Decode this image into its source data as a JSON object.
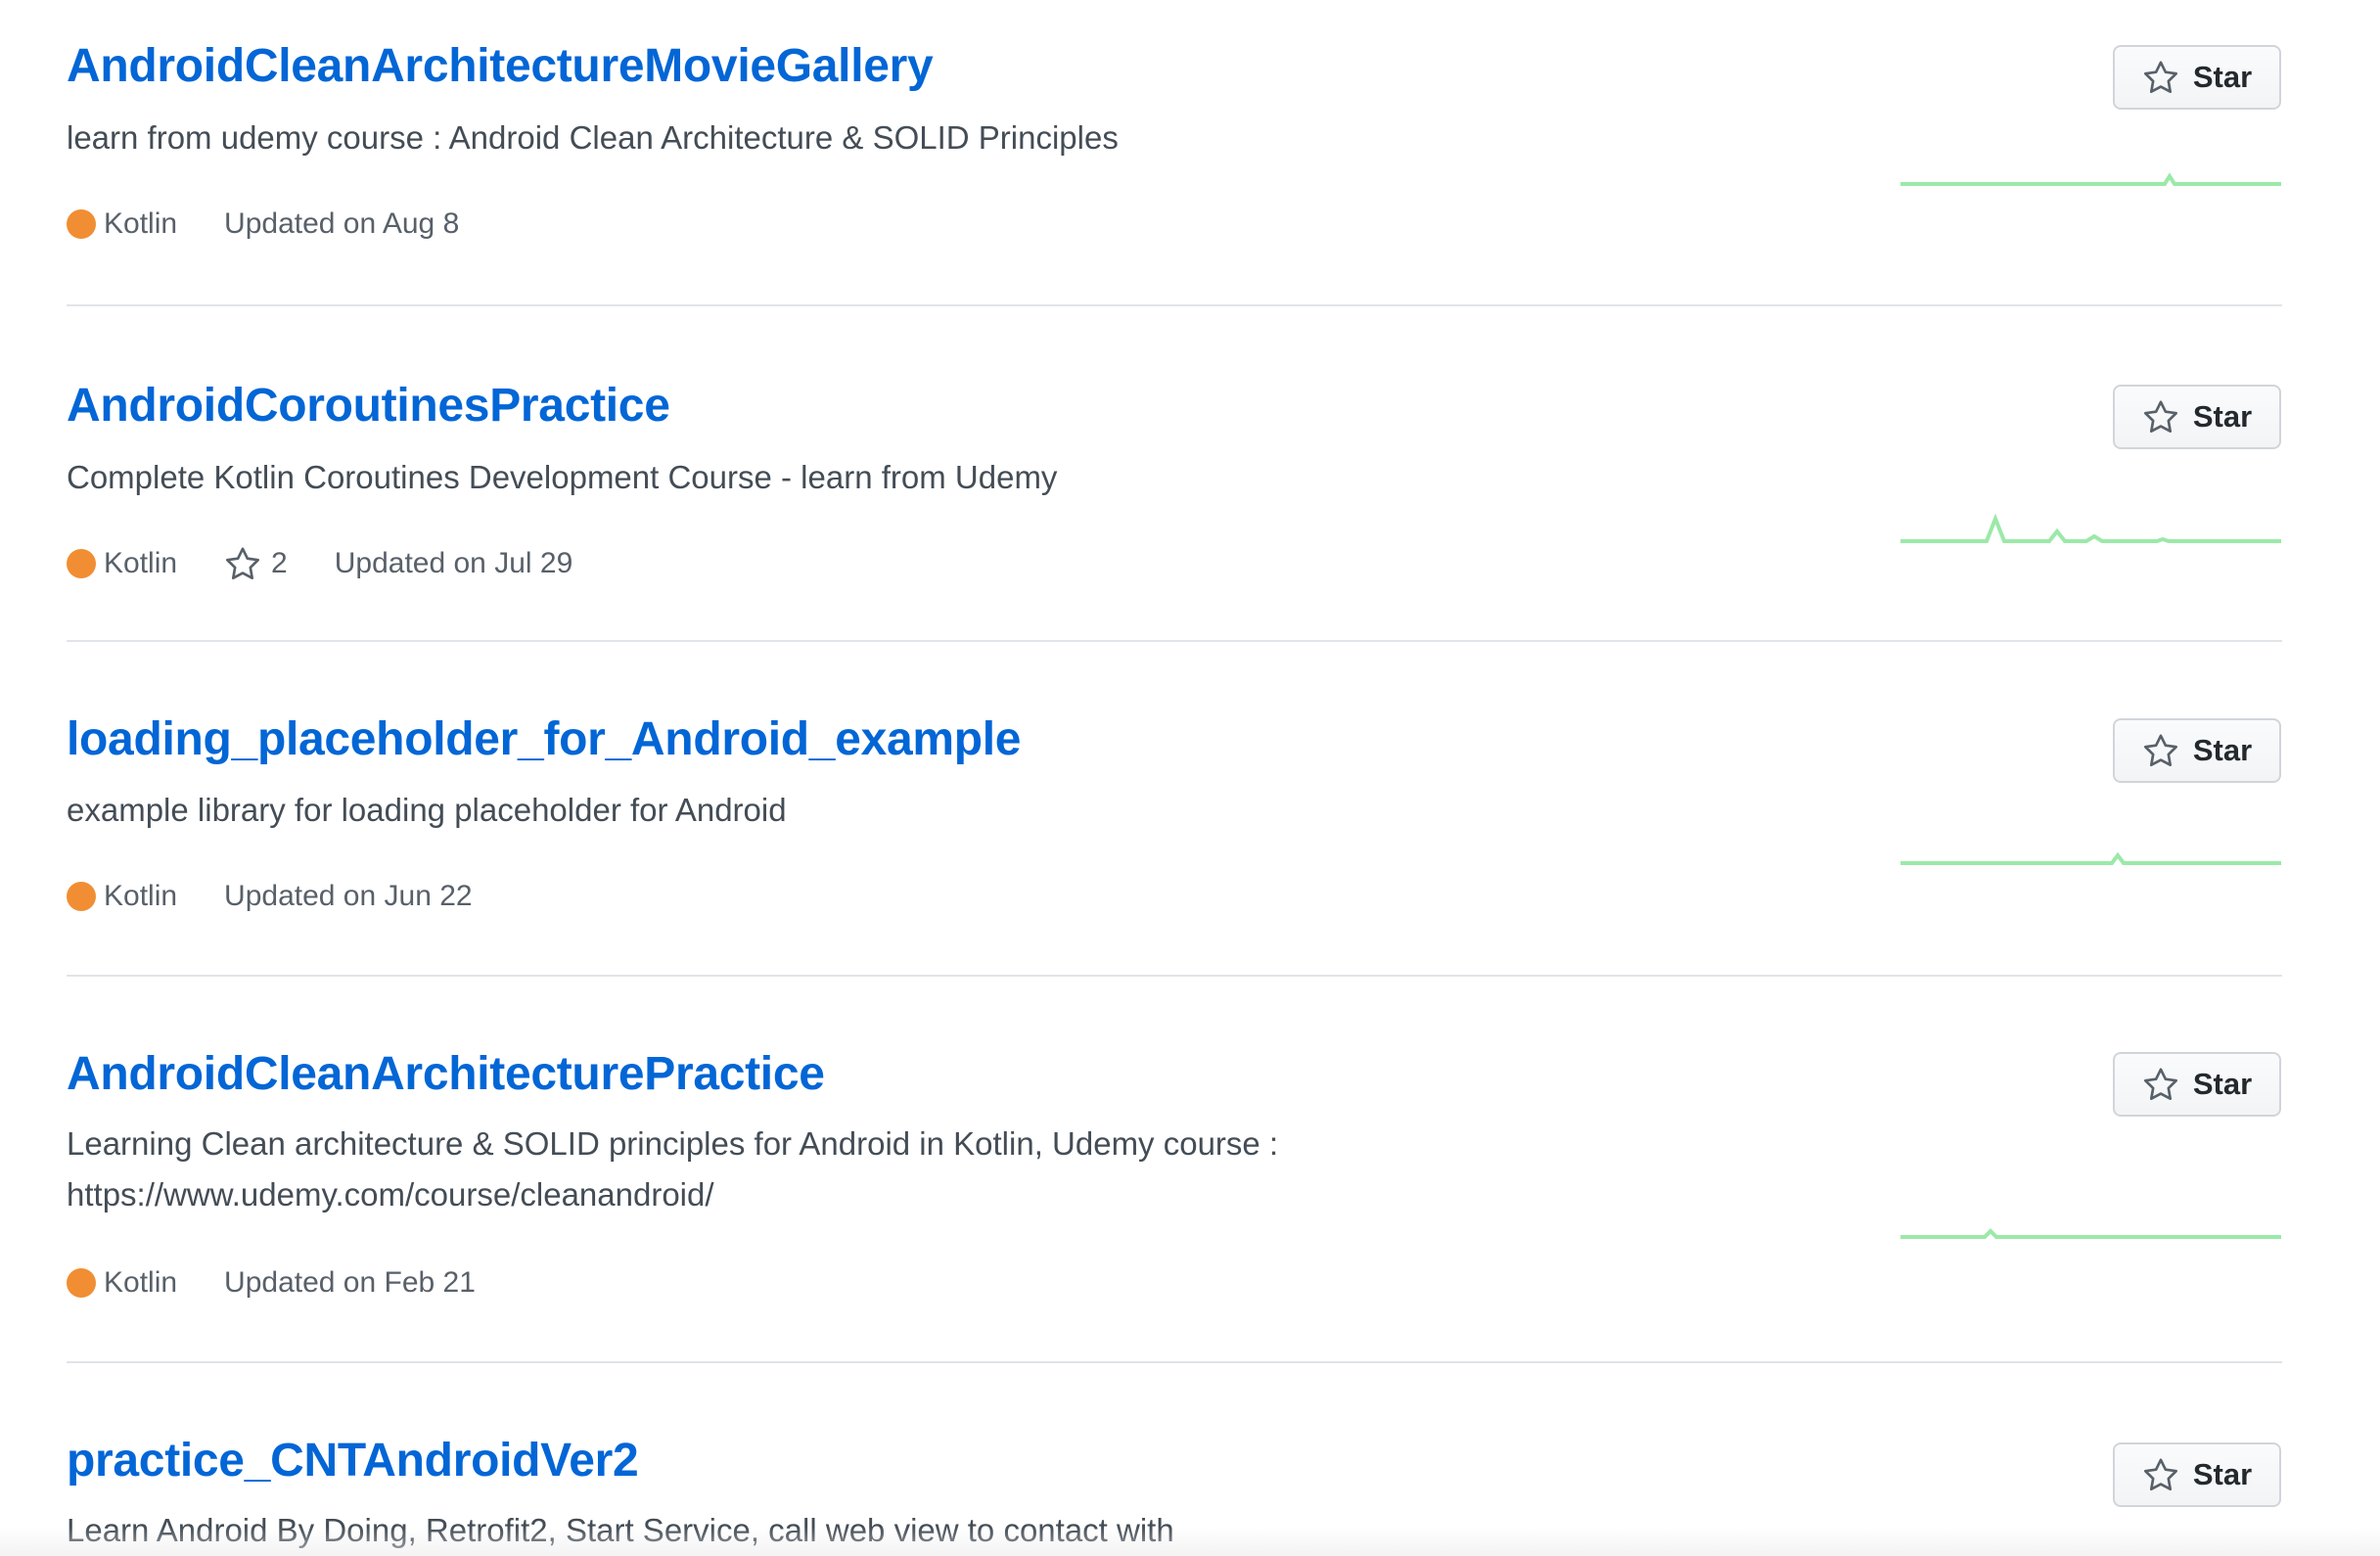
{
  "colors": {
    "link": "#0366d6",
    "kotlin": "#F18E33",
    "sparkline": "#9be9a8"
  },
  "repos": [
    {
      "name": "AndroidCleanArchitectureMovieGallery",
      "description": "learn from udemy course : Android Clean Architecture & SOLID Principles",
      "language": "Kotlin",
      "stars": "",
      "updated": "Updated on Aug 8",
      "star_button": "Star"
    },
    {
      "name": "AndroidCoroutinesPractice",
      "description": "Complete Kotlin Coroutines Development Course - learn from Udemy",
      "language": "Kotlin",
      "stars": "2",
      "updated": "Updated on Jul 29",
      "star_button": "Star"
    },
    {
      "name": "loading_placeholder_for_Android_example",
      "description": "example library for loading placeholder for Android",
      "language": "Kotlin",
      "stars": "",
      "updated": "Updated on Jun 22",
      "star_button": "Star"
    },
    {
      "name": "AndroidCleanArchitecturePractice",
      "description": "Learning Clean architecture & SOLID principles for Android in Kotlin, Udemy course : https://www.udemy.com/course/cleanandroid/",
      "language": "Kotlin",
      "stars": "",
      "updated": "Updated on Feb 21",
      "star_button": "Star"
    },
    {
      "name": "practice_CNTAndroidVer2",
      "description": "Learn Android By Doing, Retrofit2, Start Service, call web view to contact with",
      "language": "",
      "stars": "",
      "updated": "",
      "star_button": "Star"
    }
  ]
}
